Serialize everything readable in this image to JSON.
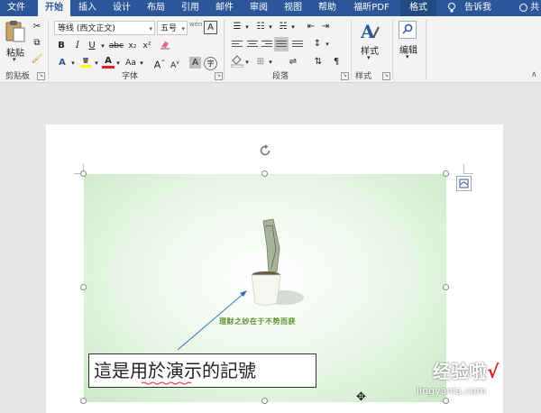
{
  "tabs": [
    {
      "label": "文件"
    },
    {
      "label": "开始"
    },
    {
      "label": "插入"
    },
    {
      "label": "设计"
    },
    {
      "label": "布局"
    },
    {
      "label": "引用"
    },
    {
      "label": "邮件"
    },
    {
      "label": "审阅"
    },
    {
      "label": "视图"
    },
    {
      "label": "帮助"
    },
    {
      "label": "福昕PDF"
    },
    {
      "label": "格式"
    },
    {
      "label": "告诉我"
    },
    {
      "label": "共"
    }
  ],
  "ribbon": {
    "clipboard": {
      "paste": "粘贴",
      "group": "剪贴板"
    },
    "font": {
      "name": "等线 (西文正文)",
      "size": "五号",
      "group": "字体",
      "bold": "B",
      "italic": "I",
      "underline": "U",
      "strike": "abc",
      "sub": "x₂",
      "sup": "x²",
      "aa_case": "Aa",
      "grow": "A",
      "shrink": "A",
      "char_shade": "A",
      "enclose": "字",
      "phonetic": "wén",
      "char_border": "A"
    },
    "paragraph": {
      "group": "段落"
    },
    "styles": {
      "label": "样式",
      "group": "样式"
    },
    "editing": {
      "label": "编辑"
    }
  },
  "document": {
    "textbox": "這是用於演示的記號",
    "picture_caption": "理财之妙在于不势而获"
  },
  "watermark": {
    "line1": "经验啦",
    "check": "√",
    "line2": "jingyanla.com"
  },
  "colors": {
    "accent": "#2b579a",
    "ribbon_bg": "#f3f3f3",
    "canvas_bg": "#e6e6e6",
    "arrow": "#3b6fb6"
  }
}
